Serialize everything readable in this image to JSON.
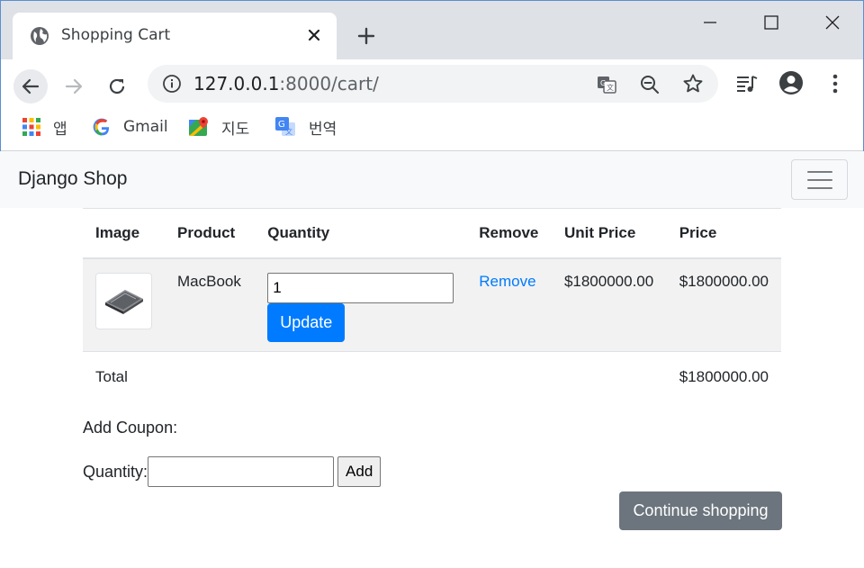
{
  "browser": {
    "tab_title": "Shopping Cart",
    "url_host": "127.0.0.1",
    "url_rest": ":8000/cart/",
    "bookmarks": [
      {
        "label": "앱",
        "icon": "apps-grid-icon"
      },
      {
        "label": "Gmail",
        "icon": "google-icon"
      },
      {
        "label": "지도",
        "icon": "maps-icon"
      },
      {
        "label": "번역",
        "icon": "translate-icon"
      }
    ]
  },
  "navbar": {
    "brand": "Django Shop"
  },
  "cart": {
    "columns": [
      "Image",
      "Product",
      "Quantity",
      "Remove",
      "Unit Price",
      "Price"
    ],
    "items": [
      {
        "image": "laptop-image",
        "product": "MacBook",
        "quantity": "1",
        "update_label": "Update",
        "remove_label": "Remove",
        "unit_price": "$1800000.00",
        "price": "$1800000.00"
      }
    ],
    "total_label": "Total",
    "total": "$1800000.00"
  },
  "coupon": {
    "heading": "Add Coupon:",
    "field_label": "Quantity:",
    "value": "",
    "add_label": "Add"
  },
  "actions": {
    "continue_label": "Continue shopping"
  },
  "colors": {
    "primary": "#007bff",
    "secondary": "#6c757d",
    "navbar_bg": "#f8f9fa"
  }
}
